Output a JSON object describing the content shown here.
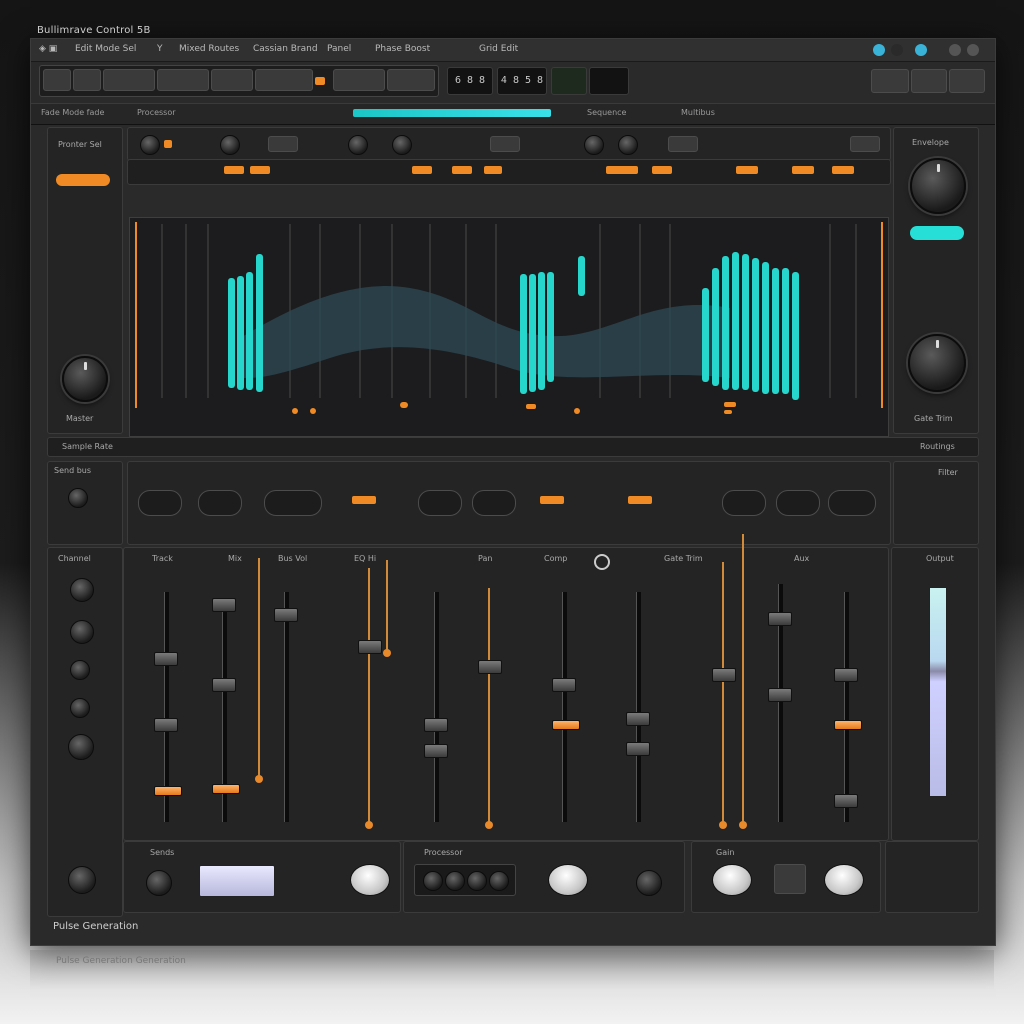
{
  "window": {
    "title": "Bullimrave Control 5B"
  },
  "menu": [
    "Edit Mode Sel",
    "Y",
    "Mixed Routes",
    "Cassian Brand",
    "Panel",
    "Phase Boost",
    "Grid Edit"
  ],
  "transport": {
    "display1": "6 8 8",
    "display2": "4 8 5 8"
  },
  "subbar": {
    "left": "Fade Mode fade",
    "mid": "Processor",
    "right": "Sequence",
    "far": "Multibus"
  },
  "top_left_panel": {
    "title": "Pronter Sel",
    "bottom": "Master"
  },
  "top_right_panel": {
    "title": "Envelope",
    "bottom": "Gate Trim"
  },
  "wave_section": {
    "left_label": "Sample Rate",
    "right_label": "Routings"
  },
  "middle": {
    "left_label": "Send bus",
    "right_label": "Filter"
  },
  "mixer": {
    "left_label": "Channel",
    "labels": [
      "Track",
      "Mix",
      "Bus Vol",
      "EQ Hi",
      "Pan",
      "Comp",
      "Gate Trim",
      "Aux"
    ],
    "right_label": "Output"
  },
  "bottom": {
    "label1": "Sends",
    "label2": "Processor",
    "label3": "Gain"
  },
  "footer": {
    "label": "Pulse Generation"
  },
  "reflection": {
    "label": "Pulse Generation Generation"
  },
  "colors": {
    "accent_orange": "#f08a24",
    "accent_cyan": "#2fe0d4",
    "panel": "#242425"
  }
}
